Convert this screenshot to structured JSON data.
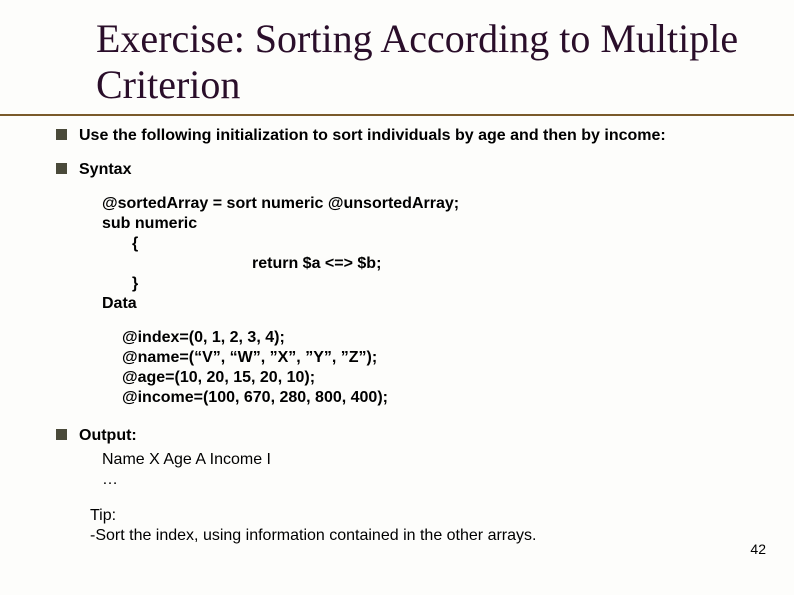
{
  "title": "Exercise: Sorting According to Multiple Criterion",
  "bullets": {
    "intro": "Use the following initialization to sort individuals by age and then by income:",
    "syntax": "Syntax",
    "output": "Output:"
  },
  "syntax": {
    "line1": "@sortedArray = sort numeric @unsortedArray;",
    "line2": "sub numeric",
    "open": "{",
    "return": "return $a <=> $b;",
    "close": "}",
    "data_label": "Data"
  },
  "data_lines": {
    "index": "@index=(0, 1, 2, 3, 4);",
    "name": "@name=(“V”, “W”, ”X”, ”Y”, ”Z”);",
    "age": "@age=(10, 20, 15, 20, 10);",
    "income": "@income=(100, 670, 280, 800, 400);"
  },
  "output": {
    "header": "Name X Age A Income I",
    "ellipsis": "…"
  },
  "tip": {
    "label": "Tip:",
    "text": "-Sort the index, using information contained in the other arrays."
  },
  "page": "42"
}
